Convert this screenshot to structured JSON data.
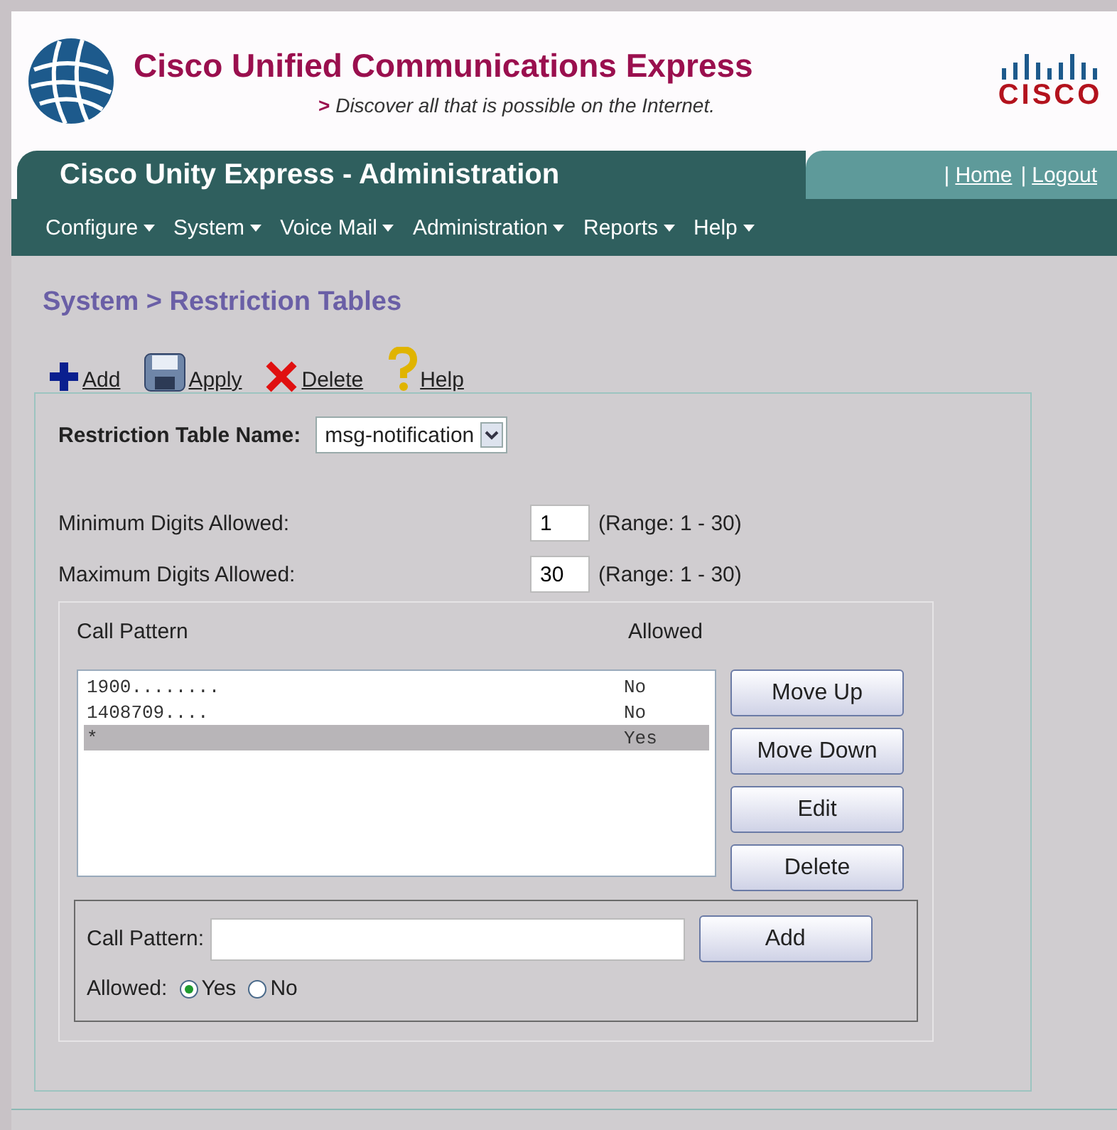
{
  "header": {
    "product": "Cisco Unified Communications Express",
    "tagline_marker": ">",
    "tagline": "Discover all that is possible on the Internet.",
    "brand": "CISCO"
  },
  "title_bar": {
    "title": "Cisco Unity Express - Administration",
    "link_separator": "|",
    "links": [
      "Home",
      "Logout"
    ]
  },
  "menu": [
    {
      "label": "Configure"
    },
    {
      "label": "System"
    },
    {
      "label": "Voice Mail"
    },
    {
      "label": "Administration"
    },
    {
      "label": "Reports"
    },
    {
      "label": "Help"
    }
  ],
  "breadcrumb": "System > Restriction Tables",
  "toolbar": [
    {
      "kind": "add",
      "label": "Add"
    },
    {
      "kind": "apply",
      "label": "Apply"
    },
    {
      "kind": "delete",
      "label": "Delete"
    },
    {
      "kind": "help",
      "label": "Help"
    }
  ],
  "table_name": {
    "label": "Restriction Table Name:",
    "value": "msg-notification"
  },
  "digits": [
    {
      "label": "Minimum Digits Allowed:",
      "value": "1",
      "range": "(Range: 1 - 30)"
    },
    {
      "label": "Maximum Digits Allowed:",
      "value": "30",
      "range": "(Range: 1 - 30)"
    }
  ],
  "patterns": {
    "columns": [
      "Call Pattern",
      "Allowed"
    ],
    "rows": [
      {
        "pattern": "1900........",
        "allowed": "No",
        "selected": false
      },
      {
        "pattern": "1408709....",
        "allowed": "No",
        "selected": false
      },
      {
        "pattern": "*",
        "allowed": "Yes",
        "selected": true
      }
    ],
    "buttons": [
      "Move Up",
      "Move Down",
      "Edit",
      "Delete"
    ]
  },
  "new_pattern": {
    "label": "Call Pattern:",
    "button": "Add",
    "allowed_label": "Allowed:",
    "options": [
      {
        "label": "Yes",
        "selected": true
      },
      {
        "label": "No",
        "selected": false
      }
    ]
  }
}
